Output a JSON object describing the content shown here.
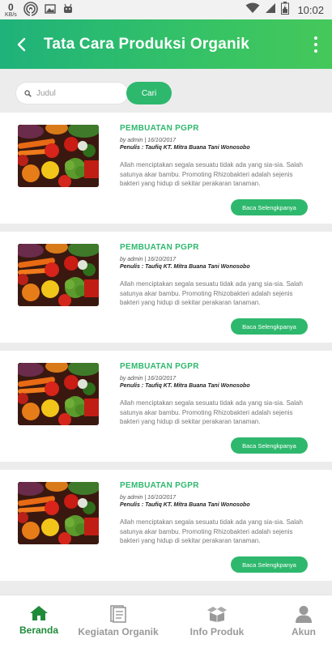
{
  "status_bar": {
    "net_speed": "0",
    "net_unit": "KB/s",
    "time": "10:02"
  },
  "app_bar": {
    "title": "Tata Cara Produksi Organik"
  },
  "search": {
    "placeholder": "Judul",
    "button_label": "Cari"
  },
  "articles": [
    {
      "title": "PEMBUATAN PGPR",
      "meta": "by admin | 16/10/2017",
      "author": "Penulis : Taufiq KT. Mitra Buana Tani Wonosobo",
      "excerpt": "Allah menciptakan segala sesuatu tidak ada yang sia-sia. Salah satunya akar bambu. Promoting Rhizobakteri adalah sejenis bakteri yang hidup di sekitar perakaran tanaman.",
      "button": "Baca Selengkpanya"
    },
    {
      "title": "PEMBUATAN PGPR",
      "meta": "by admin | 16/10/2017",
      "author": "Penulis : Taufiq KT. Mitra Buana Tani Wonosobo",
      "excerpt": "Allah menciptakan segala sesuatu tidak ada yang sia-sia. Salah satunya akar bambu. Promoting Rhizobakteri adalah sejenis bakteri yang hidup di sekitar perakaran tanaman.",
      "button": "Baca Selengkpanya"
    },
    {
      "title": "PEMBUATAN PGPR",
      "meta": "by admin | 16/10/2017",
      "author": "Penulis : Taufiq KT. Mitra Buana Tani Wonosobo",
      "excerpt": "Allah menciptakan segala sesuatu tidak ada yang sia-sia. Salah satunya akar bambu. Promoting Rhizobakteri adalah sejenis bakteri yang hidup di sekitar perakaran tanaman.",
      "button": "Baca Selengkpanya"
    },
    {
      "title": "PEMBUATAN PGPR",
      "meta": "by admin | 16/10/2017",
      "author": "Penulis : Taufiq KT. Mitra Buana Tani Wonosobo",
      "excerpt": "Allah menciptakan segala sesuatu tidak ada yang sia-sia. Salah satunya akar bambu. Promoting Rhizobakteri adalah sejenis bakteri yang hidup di sekitar perakaran tanaman.",
      "button": "Baca Selengkpanya"
    }
  ],
  "bottom_nav": [
    {
      "label": "Beranda",
      "icon": "home-icon",
      "active": true
    },
    {
      "label": "Kegiatan Organik",
      "icon": "document-icon",
      "active": false
    },
    {
      "label": "Info Produk",
      "icon": "boxes-icon",
      "active": false
    },
    {
      "label": "Akun",
      "icon": "person-icon",
      "active": false
    }
  ],
  "colors": {
    "primary": "#2eb86d",
    "app_bar_start": "#1fb27a",
    "app_bar_end": "#45c85a",
    "nav_active": "#1f8a3a",
    "nav_inactive": "#999999"
  }
}
